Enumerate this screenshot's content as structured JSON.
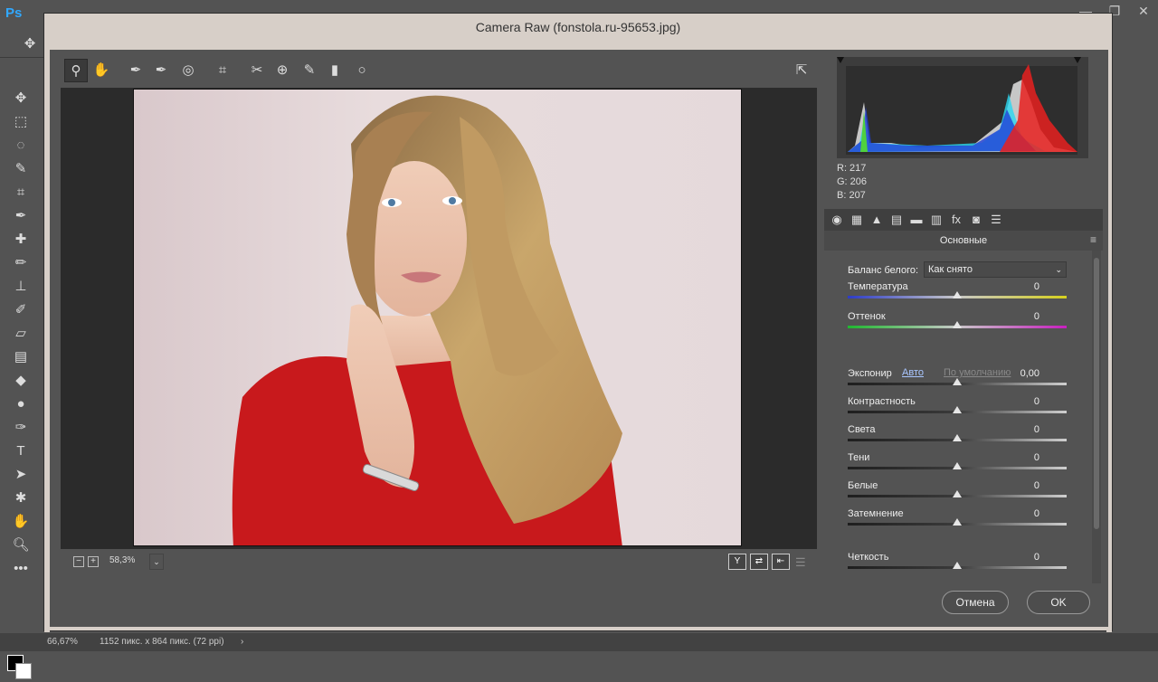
{
  "photoshop": {
    "logo": "Ps",
    "window_controls": [
      "—",
      "❐",
      "✕"
    ],
    "status": {
      "zoom": "66,67%",
      "doc_info": "1152 пикс. x 864 пикс. (72 ppi)",
      "arrow": "›"
    }
  },
  "dialog": {
    "title": "Camera Raw (fonstola.ru-95653.jpg)",
    "zoom": {
      "value": "58,3%",
      "minus": "−",
      "plus": "+",
      "dropdown": "⌄"
    },
    "view_buttons": [
      "Y",
      "⇄",
      "⇤"
    ],
    "rgb": {
      "r": "R:  217",
      "g": "G:  206",
      "b": "B:  207"
    },
    "panel_title": "Основные",
    "white_balance": {
      "label": "Баланс белого:",
      "value": "Как снято"
    },
    "links": {
      "auto": "Авто",
      "default": "По умолчанию"
    },
    "sliders": [
      {
        "label": "Температура",
        "value": "0",
        "type": "temperature"
      },
      {
        "label": "Оттенок",
        "value": "0",
        "type": "tint"
      },
      {
        "label": "Экспонир",
        "value": "0,00",
        "type": "plain"
      },
      {
        "label": "Контрастность",
        "value": "0",
        "type": "plain"
      },
      {
        "label": "Света",
        "value": "0",
        "type": "plain"
      },
      {
        "label": "Тени",
        "value": "0",
        "type": "plain"
      },
      {
        "label": "Белые",
        "value": "0",
        "type": "plain"
      },
      {
        "label": "Затемнение",
        "value": "0",
        "type": "plain"
      },
      {
        "label": "Четкость",
        "value": "0",
        "type": "plain"
      }
    ],
    "buttons": {
      "cancel": "Отмена",
      "ok": "OK"
    }
  },
  "colors": {
    "accent_blue": "#31a8ff",
    "titlebar": "#d7cfc8",
    "dress_red": "#c8191c"
  }
}
